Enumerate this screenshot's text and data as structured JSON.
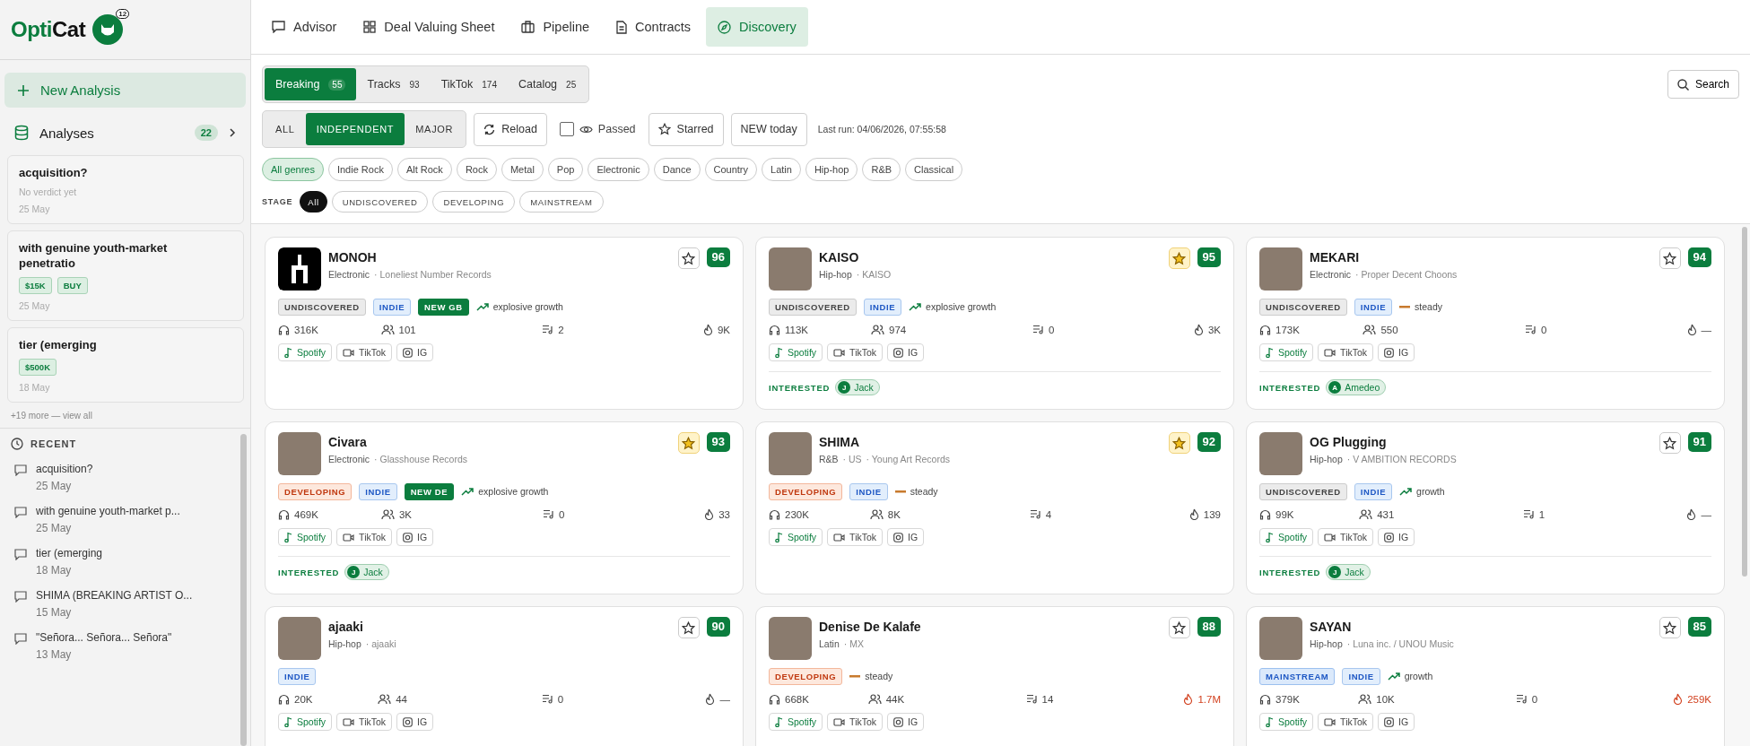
{
  "brand": {
    "part_1": "Opti",
    "part_2": "Cat",
    "notification_count": "12"
  },
  "sidebar": {
    "new_button": "New Analysis",
    "analyses": {
      "label": "Analyses",
      "count": "22",
      "items": [
        {
          "title": "acquisition?",
          "verdict": "No verdict yet",
          "date": "25 May"
        },
        {
          "title": "with genuine youth-market penetratio",
          "tags": [
            "$15K",
            "BUY"
          ],
          "date": "25 May"
        },
        {
          "title": "tier (emerging",
          "tags": [
            "$500K"
          ],
          "date": "18 May"
        }
      ],
      "more": "+19 more — view all"
    },
    "recent": {
      "label": "RECENT",
      "items": [
        {
          "title": "acquisition?",
          "date": "25 May"
        },
        {
          "title": "with genuine youth-market p...",
          "date": "25 May"
        },
        {
          "title": "tier (emerging",
          "date": "18 May"
        },
        {
          "title": "SHIMA (BREAKING ARTIST O...",
          "date": "15 May"
        },
        {
          "title": "\"Señora... Señora... Señora\"",
          "date": "13 May"
        }
      ]
    }
  },
  "nav_tabs": [
    {
      "label": "Advisor",
      "selected": false
    },
    {
      "label": "Deal Valuing Sheet",
      "selected": false
    },
    {
      "label": "Pipeline",
      "selected": false
    },
    {
      "label": "Contracts",
      "selected": false
    },
    {
      "label": "Discovery",
      "selected": true
    }
  ],
  "source_tabs": [
    {
      "label": "Breaking",
      "count": "55",
      "selected": true
    },
    {
      "label": "Tracks",
      "count": "93",
      "selected": false
    },
    {
      "label": "TikTok",
      "count": "174",
      "selected": false
    },
    {
      "label": "Catalog",
      "count": "25",
      "selected": false
    }
  ],
  "label_filter": [
    {
      "label": "ALL",
      "selected": false
    },
    {
      "label": "INDEPENDENT",
      "selected": true
    },
    {
      "label": "MAJOR",
      "selected": false
    }
  ],
  "reload": "Reload",
  "passed": {
    "label": "Passed",
    "checked": false
  },
  "starred": "Starred",
  "new_today": "NEW today",
  "last_run": "Last run: 04/06/2026, 07:55:58",
  "search": "Search",
  "genres": [
    {
      "label": "All genres",
      "selected": true
    },
    {
      "label": "Indie Rock",
      "selected": false
    },
    {
      "label": "Alt Rock",
      "selected": false
    },
    {
      "label": "Rock",
      "selected": false
    },
    {
      "label": "Metal",
      "selected": false
    },
    {
      "label": "Pop",
      "selected": false
    },
    {
      "label": "Electronic",
      "selected": false
    },
    {
      "label": "Dance",
      "selected": false
    },
    {
      "label": "Country",
      "selected": false
    },
    {
      "label": "Latin",
      "selected": false
    },
    {
      "label": "Hip-hop",
      "selected": false
    },
    {
      "label": "R&B",
      "selected": false
    },
    {
      "label": "Classical",
      "selected": false
    }
  ],
  "stage_filter": {
    "label": "STAGE",
    "options": [
      {
        "label": "All",
        "selected": true
      },
      {
        "label": "UNDISCOVERED",
        "selected": false
      },
      {
        "label": "DEVELOPING",
        "selected": false
      },
      {
        "label": "MAINSTREAM",
        "selected": false
      }
    ]
  },
  "cards": [
    {
      "name": "MONOH",
      "kind": "logo",
      "genre": "Electronic",
      "details": [
        "· Loneliest Number Records"
      ],
      "starred": false,
      "score": "96",
      "stage": {
        "label": "UNDISCOVERED",
        "kind": "undiscovered"
      },
      "tags": [
        {
          "label": "INDIE",
          "kind": "indie"
        },
        {
          "label": "NEW GB",
          "kind": "new"
        }
      ],
      "trend": {
        "label": "explosive growth",
        "kind": "up"
      },
      "listeners": "316K",
      "followers": "101",
      "playlists": "2",
      "hotness": {
        "value": "9K",
        "hot": false
      },
      "links": [
        "Spotify",
        "TikTok",
        "IG"
      ]
    },
    {
      "name": "KAISO",
      "kind": "photo",
      "genre": "Hip-hop",
      "details": [
        "· KAISO"
      ],
      "starred": true,
      "score": "95",
      "stage": {
        "label": "UNDISCOVERED",
        "kind": "undiscovered"
      },
      "tags": [
        {
          "label": "INDIE",
          "kind": "indie"
        }
      ],
      "trend": {
        "label": "explosive growth",
        "kind": "up"
      },
      "listeners": "113K",
      "followers": "974",
      "playlists": "0",
      "hotness": {
        "value": "3K",
        "hot": false
      },
      "links": [
        "Spotify",
        "TikTok",
        "IG"
      ],
      "interested": {
        "label": "INTERESTED",
        "initial": "J",
        "person": "Jack"
      }
    },
    {
      "name": "MEKARI",
      "kind": "photo",
      "genre": "Electronic",
      "details": [
        "· Proper Decent Choons"
      ],
      "starred": false,
      "score": "94",
      "stage": {
        "label": "UNDISCOVERED",
        "kind": "undiscovered"
      },
      "tags": [
        {
          "label": "INDIE",
          "kind": "indie"
        }
      ],
      "trend": {
        "label": "steady",
        "kind": "steady"
      },
      "listeners": "173K",
      "followers": "550",
      "playlists": "0",
      "hotness": {
        "value": "—",
        "hot": false
      },
      "links": [
        "Spotify",
        "TikTok",
        "IG"
      ],
      "interested": {
        "label": "INTERESTED",
        "initial": "A",
        "person": "Amedeo"
      }
    },
    {
      "name": "Civara",
      "kind": "photo",
      "genre": "Electronic",
      "details": [
        "· Glasshouse Records"
      ],
      "starred": true,
      "score": "93",
      "stage": {
        "label": "DEVELOPING",
        "kind": "developing"
      },
      "tags": [
        {
          "label": "INDIE",
          "kind": "indie"
        },
        {
          "label": "NEW DE",
          "kind": "new"
        }
      ],
      "trend": {
        "label": "explosive growth",
        "kind": "up"
      },
      "listeners": "469K",
      "followers": "3K",
      "playlists": "0",
      "hotness": {
        "value": "33",
        "hot": false
      },
      "links": [
        "Spotify",
        "TikTok",
        "IG"
      ],
      "interested": {
        "label": "INTERESTED",
        "initial": "J",
        "person": "Jack"
      }
    },
    {
      "name": "SHIMA",
      "kind": "photo",
      "genre": "R&B",
      "details": [
        "· US",
        "· Young Art Records"
      ],
      "starred": true,
      "score": "92",
      "stage": {
        "label": "DEVELOPING",
        "kind": "developing"
      },
      "tags": [
        {
          "label": "INDIE",
          "kind": "indie"
        }
      ],
      "trend": {
        "label": "steady",
        "kind": "steady"
      },
      "listeners": "230K",
      "followers": "8K",
      "playlists": "4",
      "hotness": {
        "value": "139",
        "hot": false
      },
      "links": [
        "Spotify",
        "TikTok",
        "IG"
      ]
    },
    {
      "name": "OG Plugging",
      "kind": "photo",
      "genre": "Hip-hop",
      "details": [
        "· V AMBITION RECORDS"
      ],
      "starred": false,
      "score": "91",
      "stage": {
        "label": "UNDISCOVERED",
        "kind": "undiscovered"
      },
      "tags": [
        {
          "label": "INDIE",
          "kind": "indie"
        }
      ],
      "trend": {
        "label": "growth",
        "kind": "up"
      },
      "listeners": "99K",
      "followers": "431",
      "playlists": "1",
      "hotness": {
        "value": "—",
        "hot": false
      },
      "links": [
        "Spotify",
        "TikTok",
        "IG"
      ],
      "interested": {
        "label": "INTERESTED",
        "initial": "J",
        "person": "Jack"
      }
    },
    {
      "name": "ajaaki",
      "kind": "photo",
      "genre": "Hip-hop",
      "details": [
        "· ajaaki"
      ],
      "starred": false,
      "score": "90",
      "tags": [
        {
          "label": "INDIE",
          "kind": "indie"
        }
      ],
      "listeners": "20K",
      "followers": "44",
      "playlists": "0",
      "hotness": {
        "value": "—",
        "hot": false
      },
      "links": [
        "Spotify",
        "TikTok",
        "IG"
      ]
    },
    {
      "name": "Denise De Kalafe",
      "kind": "photo",
      "genre": "Latin",
      "details": [
        "· MX"
      ],
      "starred": false,
      "score": "88",
      "stage": {
        "label": "DEVELOPING",
        "kind": "developing"
      },
      "trend": {
        "label": "steady",
        "kind": "steady"
      },
      "listeners": "668K",
      "followers": "44K",
      "playlists": "14",
      "hotness": {
        "value": "1.7M",
        "hot": true
      },
      "links": [
        "Spotify",
        "TikTok",
        "IG"
      ]
    },
    {
      "name": "SAYAN",
      "kind": "photo",
      "genre": "Hip-hop",
      "details": [
        "· Luna inc. / UNOU Music"
      ],
      "starred": false,
      "score": "85",
      "stage": {
        "label": "MAINSTREAM",
        "kind": "mainstream"
      },
      "tags": [
        {
          "label": "INDIE",
          "kind": "indie"
        }
      ],
      "trend": {
        "label": "growth",
        "kind": "up"
      },
      "listeners": "379K",
      "followers": "10K",
      "playlists": "0",
      "hotness": {
        "value": "259K",
        "hot": true
      },
      "links": [
        "Spotify",
        "TikTok",
        "IG"
      ]
    }
  ]
}
